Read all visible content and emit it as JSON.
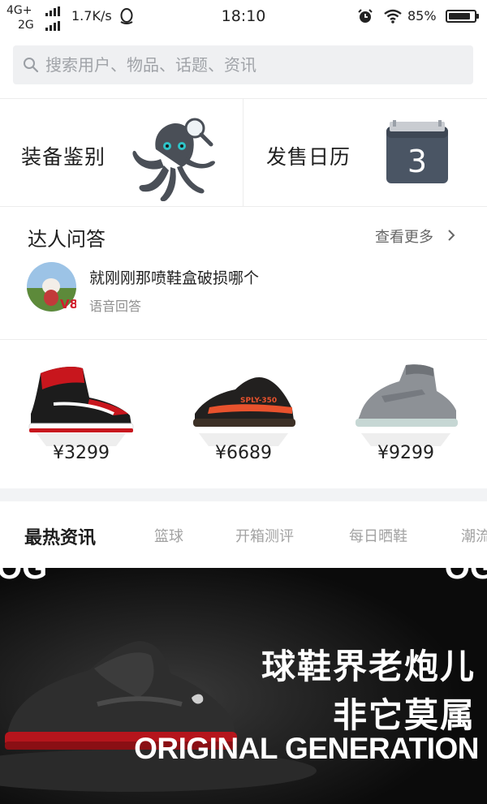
{
  "status_bar": {
    "network_top": "4G+",
    "network_bottom": "2G",
    "speed": "1.7K/s",
    "time": "18:10",
    "battery": "85%",
    "battery_level": 0.85
  },
  "search": {
    "placeholder": "搜索用户、物品、话题、资讯"
  },
  "tools": [
    {
      "label": "装备鉴别",
      "icon": "octopus-magnifier-icon"
    },
    {
      "label": "发售日历",
      "icon": "calendar-icon",
      "calendar_day": "3"
    }
  ],
  "qa": {
    "title": "达人问答",
    "more": "查看更多",
    "question": "就刚刚那喷鞋盒破损哪个",
    "answer_type": "语音回答",
    "avatar_badge": "V8"
  },
  "shoes": [
    {
      "price": "¥3299",
      "color": "#c8161d"
    },
    {
      "price": "¥6689",
      "color": "#e8522d"
    },
    {
      "price": "¥9299",
      "color": "#8d9196"
    }
  ],
  "tabs": [
    "最热资讯",
    "篮球",
    "开箱测评",
    "每日晒鞋",
    "潮流"
  ],
  "banner": {
    "line1": "球鞋界老炮儿",
    "line2": "非它莫属",
    "line3": "ORIGINAL GENERATION",
    "corner_left": "OG",
    "corner_right": "OG"
  },
  "colors": {
    "search_bg": "#eff0f2",
    "separator": "#f2f3f5",
    "banner_bg": "#0b0b0b"
  }
}
